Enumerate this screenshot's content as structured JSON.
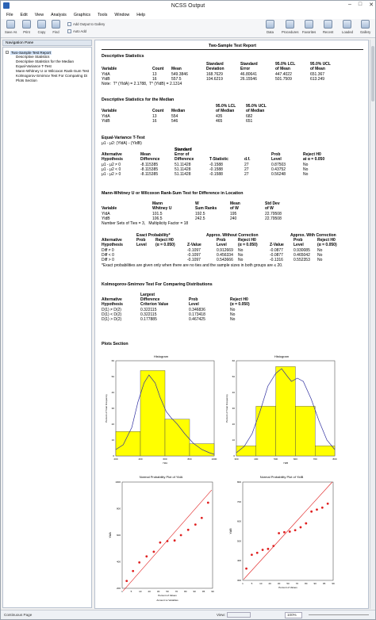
{
  "window": {
    "title": "NCSS Output",
    "min": "–",
    "max": "□",
    "close": "✕"
  },
  "menu": [
    "File",
    "Edit",
    "View",
    "Analysis",
    "Graphics",
    "Tools",
    "Window",
    "Help"
  ],
  "toolbar": {
    "save": "Save As",
    "print": "Print",
    "copy": "Copy",
    "find": "Find",
    "gallery_add": "Add Output to Gallery",
    "gallery_auto": "Auto Add",
    "data": "Data",
    "procedures": "Procedures",
    "favorites": "Favorites",
    "recent": "Recent",
    "loaded": "Loaded",
    "gallery": "Gallery"
  },
  "nav": {
    "header": "Navigation Pane",
    "root": "Two-Sample Test Report",
    "items": [
      "Descriptive Statistics",
      "Descriptive Statistics for the Median",
      "Equal-Variance T-Test",
      "Mann-Whitney U or Wilcoxon Rank-Sum Test",
      "Kolmogorov-Smirnov Test For Comparing Di",
      "Plots Section"
    ]
  },
  "report": {
    "title": "Two-Sample Test Report",
    "desc": {
      "title": "Descriptive Statistics",
      "h1": [
        "",
        "",
        "",
        "Standard",
        "Standard",
        "95.0% LCL",
        "95.0% UCL"
      ],
      "h2": [
        "Variable",
        "Count",
        "Mean",
        "Deviation",
        "Error",
        "of Mean",
        "of Mean"
      ],
      "rows": [
        [
          "YldA",
          "13",
          "549.3846",
          "168.7629",
          "46.80641",
          "447.4022",
          "651.367"
        ],
        [
          "YldB",
          "16",
          "557.5",
          "104.6219",
          "26.15546",
          "501.7509",
          "613.249"
        ]
      ],
      "note": "Note:  T* (YldA) = 2.1788,  T* (YldB) = 2.1314"
    },
    "median": {
      "title": "Descriptive Statistics for the Median",
      "h1": [
        "",
        "",
        "",
        "95.0% LCL",
        "95.0% UCL"
      ],
      "h2": [
        "Variable",
        "Count",
        "Median",
        "of Median",
        "of Median"
      ],
      "rows": [
        [
          "YldA",
          "13",
          "554",
          "435",
          "682"
        ],
        [
          "YldB",
          "16",
          "546",
          "465",
          "651"
        ]
      ]
    },
    "ttest": {
      "title": "Equal-Variance T-Test",
      "subtitle": "μ1 - μ2: (YldA) - (YldB)",
      "h0": [
        "",
        "",
        "Standard",
        "",
        "",
        "",
        ""
      ],
      "h1": [
        "Alternative",
        "Mean",
        "Error of",
        "",
        "",
        "Prob",
        "Reject H0"
      ],
      "h2": [
        "Hypothesis",
        "Difference",
        "Difference",
        "T-Statistic",
        "d.f.",
        "Level",
        "at α = 0.050"
      ],
      "rows": [
        [
          "μ1 - μ2 ≠ 0",
          "-8.115385",
          "51.11428",
          "-0.1588",
          "27",
          "0.87503",
          "No"
        ],
        [
          "μ1 - μ2 < 0",
          "-8.115385",
          "51.11428",
          "-0.1588",
          "27",
          "0.43752",
          "No"
        ],
        [
          "μ1 - μ2 > 0",
          "-8.115385",
          "51.11428",
          "-0.1588",
          "27",
          "0.56248",
          "No"
        ]
      ]
    },
    "mw": {
      "title": "Mann-Whitney U or Wilcoxon Rank-Sum Test for Difference in Location",
      "h1": [
        "",
        "Mann",
        "W",
        "Mean",
        "Std Dev"
      ],
      "h2": [
        "Variable",
        "Whitney U",
        "Sum Ranks",
        "of W",
        "of W"
      ],
      "rows": [
        [
          "YldA",
          "101.5",
          "192.5",
          "195",
          "22.79508"
        ],
        [
          "YldB",
          "106.5",
          "242.5",
          "240",
          "22.79508"
        ]
      ],
      "ties": "Number Sets of Ties = 3,   Multiplicity Factor = 18",
      "g1": [
        "Exact Probability*",
        "Approx. Without Correction",
        "Approx. With Correction"
      ],
      "h3": [
        "Alternative",
        "Prob",
        "Reject H0",
        "",
        "Prob",
        "Reject H0",
        "",
        "Prob",
        "Reject H0"
      ],
      "h4": [
        "Hypothesis",
        "Level",
        "(α = 0.050)",
        "Z-Value",
        "Level",
        "(α = 0.050)",
        "Z-Value",
        "Level",
        "(α = 0.050)"
      ],
      "rows2": [
        [
          "Diff ≠ 0",
          "",
          "",
          "-0.1097",
          "0.912669",
          "No",
          "-0.0877",
          "0.930085",
          "No"
        ],
        [
          "Diff < 0",
          "",
          "",
          "-0.1097",
          "0.456334",
          "No",
          "-0.0877",
          "0.465042",
          "No"
        ],
        [
          "Diff > 0",
          "",
          "",
          "-0.1097",
          "0.543666",
          "No",
          "-0.1316",
          "0.552353",
          "No"
        ]
      ],
      "foot": "*Exact probabilities are given only when there are no ties and the sample sizes in both groups are ≤ 20."
    },
    "ks": {
      "title": "Kolmogorov-Smirnov Test For Comparing Distributions",
      "h1": [
        "",
        "Largest",
        "",
        ""
      ],
      "h2": [
        "Alternative",
        "Difference",
        "Prob",
        "Reject H0"
      ],
      "h3": [
        "Hypothesis",
        "Criterion Value",
        "Level",
        "(α = 0.050)"
      ],
      "rows": [
        [
          "D(1) ≠ D(2)",
          "0.322115",
          "0.346836",
          "No"
        ],
        [
          "D(1) < D(2)",
          "0.322115",
          "0.173418",
          "No"
        ],
        [
          "D(1) > D(2)",
          "0.177885",
          "0.467425",
          "No"
        ]
      ]
    },
    "plots": {
      "title": "Plots Section"
    }
  },
  "chart_data": [
    {
      "type": "bar",
      "title": "Histogram",
      "xlabel": "YldA",
      "ylabel": "Percent of Total Frequency",
      "categories": [
        "200-400",
        "400-600",
        "600-800",
        "800-1000"
      ],
      "values": [
        15.4,
        53.8,
        23.1,
        7.7
      ],
      "xlim": [
        200,
        1000
      ],
      "ylim": [
        0,
        60
      ],
      "xticks": [
        "200",
        "400",
        "600",
        "800",
        "1000"
      ],
      "yticks": [
        "0",
        "10",
        "20",
        "30",
        "40",
        "50",
        "60"
      ],
      "curve": [
        [
          200,
          4
        ],
        [
          260,
          7
        ],
        [
          330,
          18
        ],
        [
          380,
          34
        ],
        [
          430,
          46
        ],
        [
          470,
          51
        ],
        [
          520,
          46
        ],
        [
          560,
          37
        ],
        [
          610,
          28
        ],
        [
          650,
          24
        ],
        [
          700,
          20
        ],
        [
          760,
          14
        ],
        [
          830,
          8
        ],
        [
          900,
          4
        ],
        [
          960,
          2
        ],
        [
          1000,
          1
        ]
      ],
      "color": "#ffff00"
    },
    {
      "type": "bar",
      "title": "Histogram",
      "xlabel": "YldB",
      "ylabel": "Percent of Total Frequency",
      "categories": [
        "300-400",
        "400-500",
        "500-600",
        "600-700",
        "700-800"
      ],
      "values": [
        6.3,
        31.3,
        56.3,
        31.3,
        6.3
      ],
      "xlim": [
        300,
        800
      ],
      "ylim": [
        0,
        60
      ],
      "xticks": [
        "300",
        "400",
        "500",
        "600",
        "700",
        "800"
      ],
      "yticks": [
        "0",
        "10",
        "20",
        "30",
        "40",
        "50",
        "60"
      ],
      "curve": [
        [
          300,
          2
        ],
        [
          340,
          6
        ],
        [
          380,
          14
        ],
        [
          420,
          28
        ],
        [
          460,
          44
        ],
        [
          500,
          52
        ],
        [
          530,
          55
        ],
        [
          560,
          50
        ],
        [
          580,
          47
        ],
        [
          610,
          49
        ],
        [
          640,
          47
        ],
        [
          680,
          36
        ],
        [
          720,
          22
        ],
        [
          760,
          10
        ],
        [
          800,
          4
        ]
      ],
      "color": "#ffff00"
    },
    {
      "type": "scatter",
      "title": "Normal Probability Plot of YldA",
      "xlabel": "Percent of Values",
      "ylabel": "YldA",
      "footer": "Amount vs Variables",
      "xlim": [
        0,
        100
      ],
      "ylim": [
        200,
        1000
      ],
      "xticks": [
        "1",
        "5",
        "10",
        "20",
        "30",
        "50",
        "70",
        "80",
        "90",
        "95",
        "99"
      ],
      "yticks": [
        "200",
        "400",
        "600",
        "800",
        "1000"
      ],
      "x": [
        5,
        12,
        19,
        27,
        35,
        42,
        50,
        58,
        65,
        73,
        81,
        88,
        95
      ],
      "y": [
        255,
        330,
        395,
        440,
        475,
        545,
        555,
        560,
        600,
        640,
        680,
        730,
        845
      ],
      "line": [
        [
          1,
          180
        ],
        [
          99,
          940
        ]
      ],
      "color": "#e02020"
    },
    {
      "type": "scatter",
      "title": "Normal Probability Plot of YldB",
      "xlabel": "Percent of Values",
      "ylabel": "YldB",
      "xlim": [
        0,
        100
      ],
      "ylim": [
        300,
        800
      ],
      "xticks": [
        "1",
        "5",
        "10",
        "20",
        "30",
        "50",
        "70",
        "80",
        "90",
        "95",
        "99"
      ],
      "yticks": [
        "300",
        "400",
        "500",
        "600",
        "700",
        "800"
      ],
      "x": [
        4,
        10,
        16,
        22,
        28,
        34,
        40,
        46,
        52,
        58,
        64,
        70,
        76,
        82,
        88,
        94
      ],
      "y": [
        360,
        430,
        440,
        455,
        460,
        475,
        540,
        545,
        548,
        555,
        570,
        590,
        650,
        660,
        670,
        690
      ],
      "line": [
        [
          1,
          305
        ],
        [
          99,
          800
        ]
      ],
      "color": "#e02020"
    }
  ],
  "status": {
    "page": "Continuous Page",
    "view": "View:",
    "zoom": "100%"
  }
}
